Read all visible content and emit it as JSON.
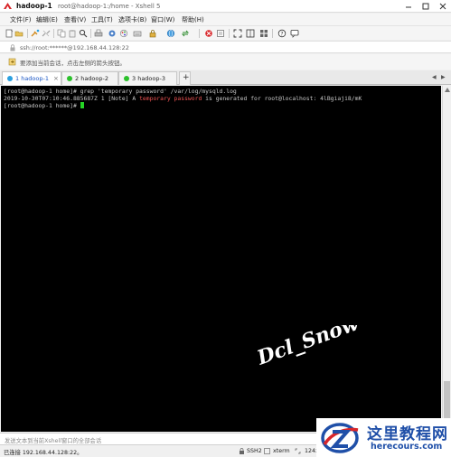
{
  "window": {
    "title": "hadoop-1",
    "subtitle": "root@hadoop-1:/home - Xshell 5"
  },
  "menu": [
    "文件(F)",
    "编辑(E)",
    "查看(V)",
    "工具(T)",
    "选项卡(B)",
    "窗口(W)",
    "帮助(H)"
  ],
  "address": {
    "value": "ssh://root:******@192.168.44.128:22"
  },
  "hint": {
    "text": "要添加当前会话，点击左侧的箭头按钮。"
  },
  "tabs": [
    {
      "label": "1 hadoop-1",
      "dot_color": "#2aa0e0",
      "active": true
    },
    {
      "label": "2 hadoop-2",
      "dot_color": "#2bc12b",
      "active": false
    },
    {
      "label": "3 hadoop-3",
      "dot_color": "#2bc12b",
      "active": false
    }
  ],
  "terminal": {
    "line1": "[root@hadoop-1 home]# grep 'temporary password' /var/log/mysqld.log",
    "line2_pre": "2019-10-30T07:10:46.885687Z 1 [Note] A ",
    "line2_hl": "temporary password",
    "line2_post": " is generated for root@localhost: 4lBgiaji8/mK",
    "line3": "[root@hadoop-1 home]# "
  },
  "watermark": {
    "text": "Dcl_Snow"
  },
  "sendbar": {
    "placeholder": "发送文本到当前Xshell窗口的全部会话"
  },
  "status": {
    "connection": "已连接 192.168.44.128:22。",
    "protocol": "SSH2",
    "terminal_type": "xterm",
    "size": "124x"
  },
  "logo": {
    "name": "这里教程网",
    "url": "herecours.com"
  },
  "colors": {
    "terminal_bg": "#000000",
    "terminal_fg": "#c8c8c8",
    "highlight": "#f05454",
    "cursor": "#25d425",
    "tab_active_text": "#1a56c4",
    "logo_blue": "#1f4fa8",
    "logo_red": "#d8262a"
  }
}
